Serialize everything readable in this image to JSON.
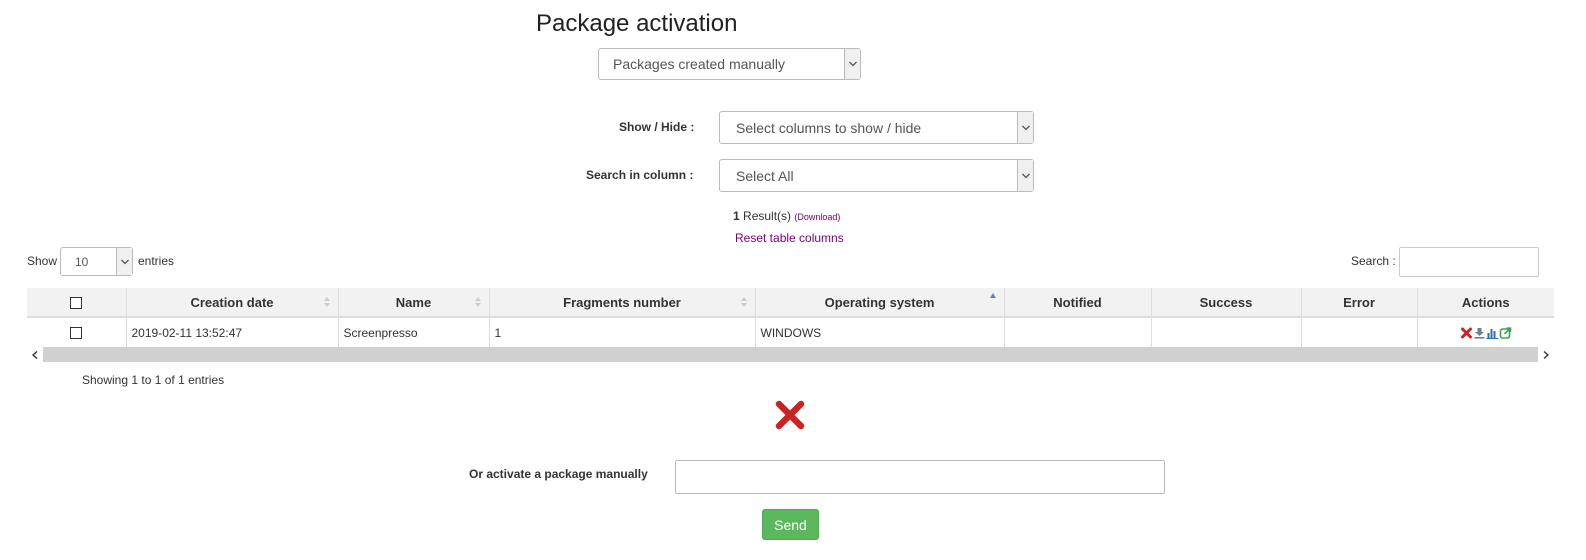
{
  "page": {
    "title": "Package activation"
  },
  "package_type": {
    "selected": "Packages created manually"
  },
  "show_hide": {
    "label": "Show / Hide :",
    "selected": "Select columns to show / hide"
  },
  "search_column": {
    "label": "Search in column :",
    "selected": "Select All"
  },
  "results": {
    "count": "1",
    "suffix": "Result(s)",
    "download": "(Download)",
    "reset": "Reset table columns"
  },
  "length": {
    "show": "Show",
    "value": "10",
    "entries": "entries"
  },
  "search": {
    "label": "Search :",
    "value": ""
  },
  "table": {
    "columns": [
      "Creation date",
      "Name",
      "Fragments number",
      "Operating system",
      "Notified",
      "Success",
      "Error",
      "Actions"
    ],
    "rows": [
      {
        "creation_date": "2019-02-11 13:52:47",
        "name": "Screenpresso",
        "fragments": "1",
        "os": "WINDOWS",
        "notified": "",
        "success": "",
        "error": ""
      }
    ],
    "sort_column": "Operating system",
    "action_icons": [
      "delete-icon",
      "download-icon",
      "stats-icon",
      "export-icon"
    ]
  },
  "info": {
    "showing": "Showing 1 to 1 of 1 entries"
  },
  "manual": {
    "label": "Or activate a package manually",
    "value": "",
    "send": "Send"
  },
  "colors": {
    "link": "#800080",
    "send": "#5cb85c",
    "delete": "#cc2222"
  }
}
